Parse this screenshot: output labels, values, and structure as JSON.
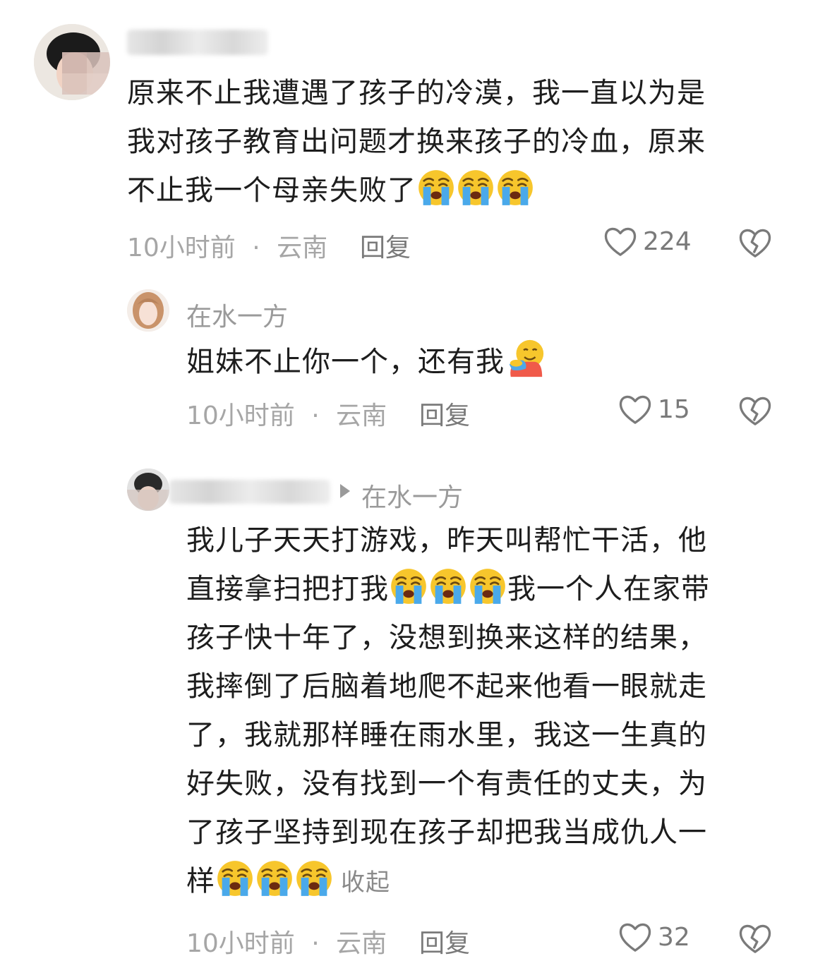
{
  "comments": [
    {
      "author": "",
      "text_lines": [
        "原来不止我遭遇了孩子的冷漠，我一直以为是",
        "我对孩子教育出问题才换来孩子的冷血，原来",
        "不止我一个母亲失败了"
      ],
      "time": "10小时前",
      "sep": "·",
      "location": "云南",
      "reply_label": "回复",
      "likes": "224"
    },
    {
      "author": "在水一方",
      "text": "姐妹不止你一个，还有我",
      "time": "10小时前",
      "sep": "·",
      "location": "云南",
      "reply_label": "回复",
      "likes": "15"
    },
    {
      "author": "",
      "reply_to": "在水一方",
      "text_lines": [
        "我儿子天天打游戏，昨天叫帮忙干活，他",
        "直接拿扫把打我",
        "我一个人在家带",
        "孩子快十年了，没想到换来这样的结果，",
        "我摔倒了后脑着地爬不起来他看一眼就走",
        "了，我就那样睡在雨水里，我这一生真的",
        "好失败，没有找到一个有责任的丈夫，为",
        "了孩子坚持到现在孩子却把我当成仇人一",
        "样"
      ],
      "collapse_label": "收起",
      "time": "10小时前",
      "sep": "·",
      "location": "云南",
      "reply_label": "回复",
      "likes": "32"
    }
  ],
  "icons": {
    "like": "heart-outline-icon",
    "dislike": "broken-heart-icon",
    "crying": "loudly-crying-emoji",
    "hug": "hugging-emoji"
  },
  "colors": {
    "text": "#1d1d1d",
    "meta": "#a6a6a6",
    "action": "#7a7a7a"
  }
}
